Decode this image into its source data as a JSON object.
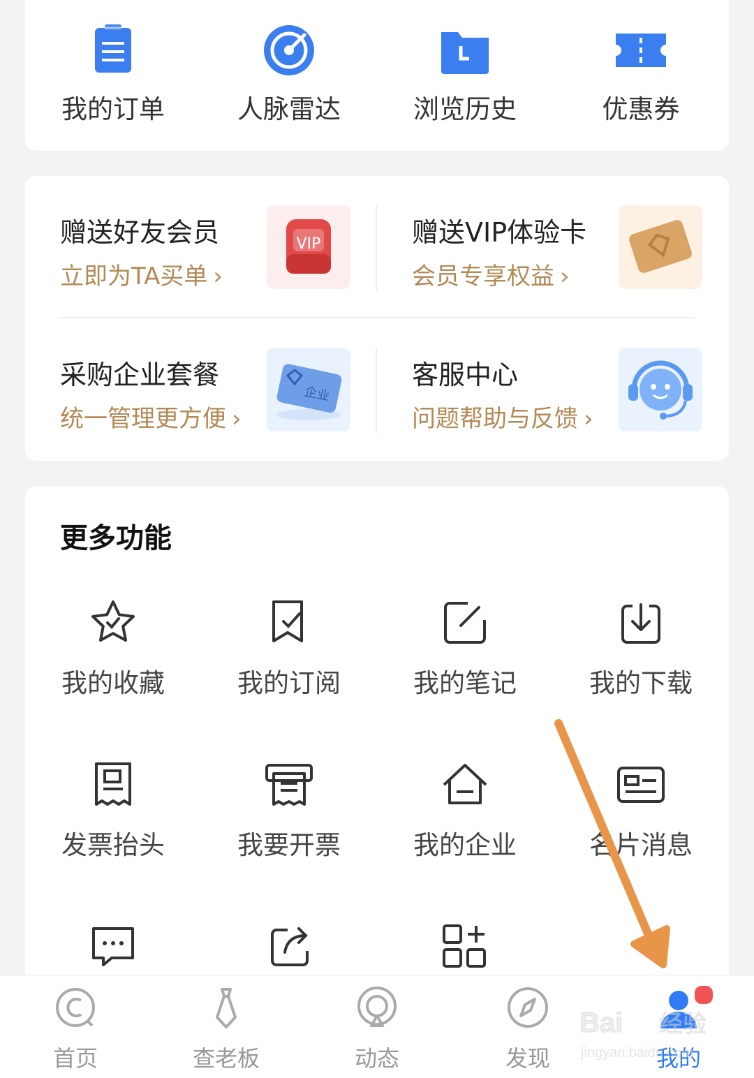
{
  "quick_actions": [
    {
      "label": "我的订单",
      "icon": "clipboard-icon"
    },
    {
      "label": "人脉雷达",
      "icon": "radar-icon"
    },
    {
      "label": "浏览历史",
      "icon": "history-folder-icon"
    },
    {
      "label": "优惠券",
      "icon": "coupon-icon"
    }
  ],
  "promos": [
    {
      "title": "赠送好友会员",
      "subtitle": "立即为TA买单",
      "image": "vip-gift-icon",
      "image_text": "VIP"
    },
    {
      "title": "赠送VIP体验卡",
      "subtitle": "会员专享权益",
      "image": "vip-card-icon"
    },
    {
      "title": "采购企业套餐",
      "subtitle": "统一管理更方便",
      "image": "enterprise-card-icon",
      "image_text": "企业"
    },
    {
      "title": "客服中心",
      "subtitle": "问题帮助与反馈",
      "image": "customer-service-icon"
    }
  ],
  "more": {
    "title": "更多功能",
    "items": [
      {
        "label": "我的收藏",
        "icon": "star-icon"
      },
      {
        "label": "我的订阅",
        "icon": "subscribe-icon"
      },
      {
        "label": "我的笔记",
        "icon": "note-edit-icon"
      },
      {
        "label": "我的下载",
        "icon": "download-icon"
      },
      {
        "label": "发票抬头",
        "icon": "invoice-title-icon"
      },
      {
        "label": "我要开票",
        "icon": "invoice-print-icon"
      },
      {
        "label": "我的企业",
        "icon": "enterprise-home-icon"
      },
      {
        "label": "名片消息",
        "icon": "business-card-icon"
      },
      {
        "label": "",
        "icon": "message-icon"
      },
      {
        "label": "",
        "icon": "share-icon"
      },
      {
        "label": "",
        "icon": "add-app-icon"
      }
    ]
  },
  "tabbar": [
    {
      "label": "首页",
      "icon": "home-icon",
      "active": false
    },
    {
      "label": "查老板",
      "icon": "boss-tie-icon",
      "active": false
    },
    {
      "label": "动态",
      "icon": "feed-icon",
      "active": false
    },
    {
      "label": "发现",
      "icon": "compass-icon",
      "active": false
    },
    {
      "label": "我的",
      "icon": "profile-icon",
      "active": true
    }
  ],
  "watermark": {
    "line1": "Bai",
    "line2": "经验",
    "url": "jingyan.baidu.com"
  },
  "colors": {
    "accent": "#2f7cf6",
    "gold": "#b38a55",
    "arrow": "#e8954a",
    "badge": "#f25454"
  }
}
